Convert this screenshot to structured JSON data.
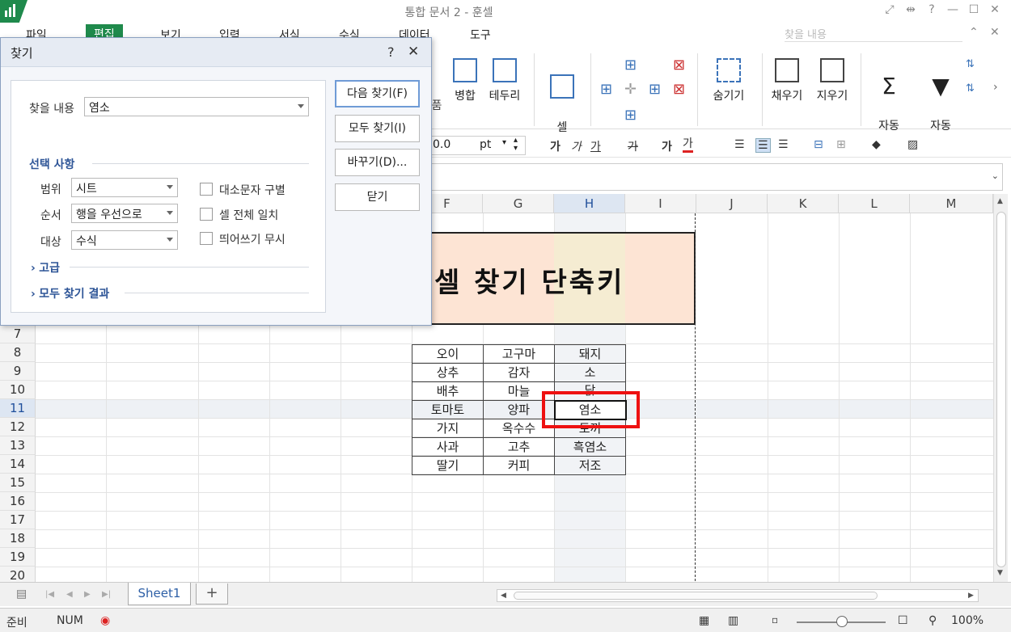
{
  "window": {
    "title": "통합 문서 2 - 훈셀"
  },
  "menu": {
    "items": [
      "파일",
      "편집",
      "보기",
      "입력",
      "서식",
      "수식",
      "데이터",
      "도구"
    ],
    "active": "편집",
    "search_placeholder": "찾을 내용"
  },
  "ribbon": {
    "merge": "병합",
    "border": "테두리",
    "cell_edit": "셀\n편집",
    "hide": "숨기기",
    "fill": "채우기",
    "clear": "지우기",
    "autosum": "자동\n합계",
    "autofilter": "자동\n필터",
    "partial_left": "품"
  },
  "format_bar": {
    "font_size": "0.0",
    "unit": "pt"
  },
  "columns": [
    "F",
    "G",
    "H",
    "I",
    "J",
    "K",
    "L",
    "M"
  ],
  "selected_column": "H",
  "rows": [
    "7",
    "8",
    "9",
    "10",
    "11",
    "12",
    "13",
    "14",
    "15",
    "16",
    "17",
    "18",
    "19",
    "20"
  ],
  "selected_row": "11",
  "sheet_title": "셀 찾기 단축키",
  "table": [
    [
      "오이",
      "고구마",
      "돼지"
    ],
    [
      "상추",
      "감자",
      "소"
    ],
    [
      "배추",
      "마늘",
      "닭"
    ],
    [
      "토마토",
      "양파",
      "염소"
    ],
    [
      "가지",
      "옥수수",
      "토끼"
    ],
    [
      "사과",
      "고추",
      "흑염소"
    ],
    [
      "딸기",
      "커피",
      "저조"
    ]
  ],
  "sheet_tab": "Sheet1",
  "status": {
    "ready": "준비",
    "num": "NUM",
    "zoom": "100%"
  },
  "dialog": {
    "title": "찾기",
    "find_label": "찾을 내용",
    "find_value": "염소",
    "options_title": "선택 사항",
    "scope_label": "범위",
    "scope_value": "시트",
    "order_label": "순서",
    "order_value": "행을 우선으로",
    "target_label": "대상",
    "target_value": "수식",
    "match_case": "대소문자 구별",
    "whole_cell": "셀 전체 일치",
    "ignore_space": "띄어쓰기 무시",
    "advanced": "고급",
    "find_all_results": "모두 찾기 결과",
    "find_next": "다음 찾기(F)",
    "find_all": "모두 찾기(I)",
    "replace": "바꾸기(D)...",
    "close": "닫기"
  }
}
